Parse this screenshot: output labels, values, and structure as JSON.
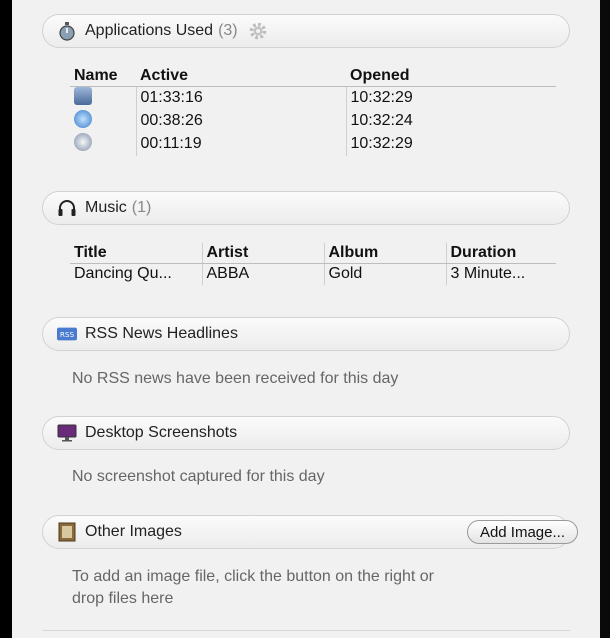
{
  "applications": {
    "title": "Applications Used",
    "count": "(3)",
    "headers": {
      "name": "Name",
      "active": "Active",
      "opened": "Opened"
    },
    "rows": [
      {
        "icon": "preview-app-icon",
        "active": "01:33:16",
        "opened": "10:32:29"
      },
      {
        "icon": "safari-app-icon",
        "active": "00:38:26",
        "opened": "10:32:24"
      },
      {
        "icon": "system-app-icon",
        "active": "00:11:19",
        "opened": "10:32:29"
      }
    ]
  },
  "music": {
    "title": "Music",
    "count": "(1)",
    "headers": {
      "title": "Title",
      "artist": "Artist",
      "album": "Album",
      "duration": "Duration"
    },
    "rows": [
      {
        "title": "Dancing Qu...",
        "artist": "ABBA",
        "album": "Gold",
        "duration": "3 Minute..."
      }
    ]
  },
  "rss": {
    "title": "RSS News Headlines",
    "message": "No RSS news have been received for this day"
  },
  "screenshots": {
    "title": "Desktop Screenshots",
    "message": "No screenshot captured for this day"
  },
  "images": {
    "title": "Other Images",
    "button": "Add Image...",
    "message_line1": "To add an image file, click the button on the right or",
    "message_line2": "drop files here"
  },
  "colors": {
    "panel": "#f1f1f1",
    "header_border": "#d2d2d2",
    "muted_text": "#666666"
  }
}
